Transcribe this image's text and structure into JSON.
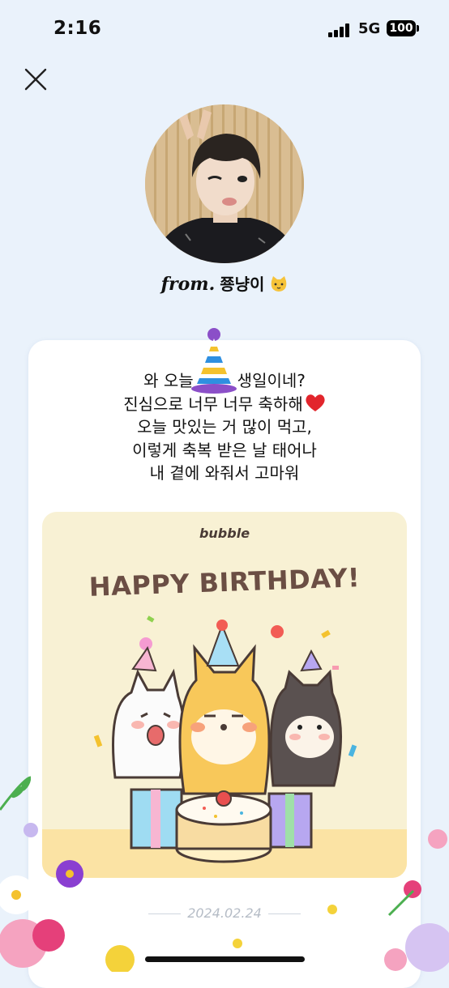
{
  "status_bar": {
    "time": "2:16",
    "network": "5G",
    "battery": "100"
  },
  "header": {
    "from_label": "from.",
    "sender_name": "쭁냥이"
  },
  "message": {
    "lines": [
      "와 오늘",
      "생일이네?",
      "진심으로 너무 너무 축하해",
      "오늘 맛있는 거 많이 먹고,",
      "이렇게 축복 받은 날 태어나",
      "내 곁에 와줘서 고마워"
    ]
  },
  "birthday_card": {
    "brand": "bubble",
    "title": "HAPPY BIRTHDAY!"
  },
  "footer": {
    "date": "2024.02.24"
  },
  "colors": {
    "background": "#eaf2fb",
    "card": "#ffffff",
    "birthday_card_bg": "#f8f1d4",
    "title_brown": "#6b4e44"
  }
}
